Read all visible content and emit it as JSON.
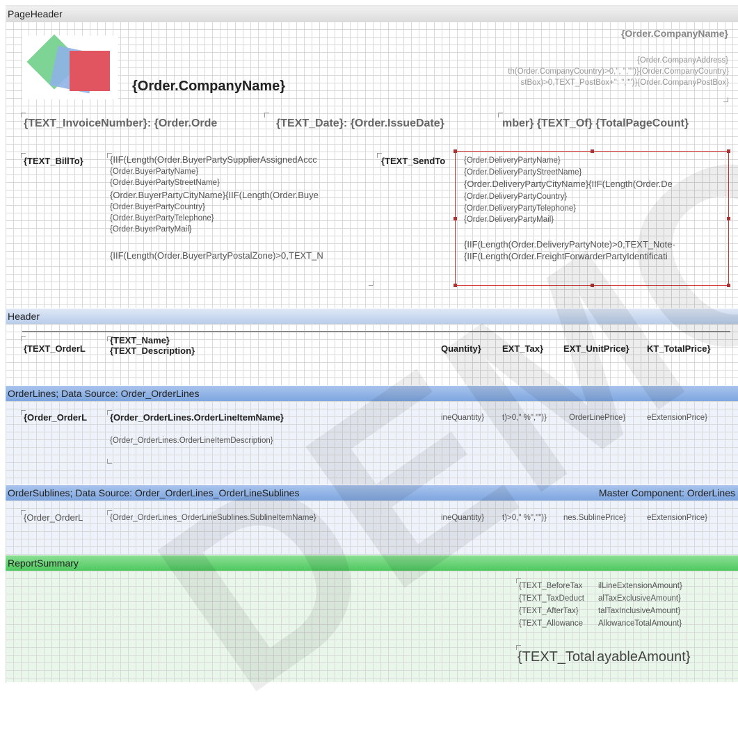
{
  "bands": {
    "page_header": {
      "title": "PageHeader"
    },
    "header": {
      "title": "Header"
    },
    "order_lines": {
      "title": "OrderLines; Data Source: Order_OrderLines"
    },
    "order_sublines": {
      "title": "OrderSublines; Data Source: Order_OrderLines_OrderLineSublines",
      "master": "Master Component: OrderLines"
    },
    "report_summary": {
      "title": "ReportSummary"
    }
  },
  "page_header": {
    "company_name_big": "{Order.CompanyName}",
    "company_name_right": "{Order.CompanyName}",
    "company_address": "{Order.CompanyAddress}",
    "company_country_expr": "th(Order.CompanyCountry)>0,\", \",\"\")}{Order.CompanyCountry}",
    "postbox_expr": "stBox)>0,TEXT_PostBox+\": \",\"\")}{Order.CompanyPostBox}",
    "invoice_number": "{TEXT_InvoiceNumber}: {Order.Orde",
    "date": "{TEXT_Date}: {Order.IssueDate}",
    "page_count": "mber} {TEXT_Of} {TotalPageCount}",
    "bill_to_label": "{TEXT_BillTo}",
    "send_to_label": "{TEXT_SendTo",
    "buyer_lines": [
      "{IIF(Length(Order.BuyerPartySupplierAssignedAccc",
      "{Order.BuyerPartyName}",
      "{Order.BuyerPartyStreetName}",
      "{Order.BuyerPartyCityName}{IIF(Length(Order.Buye",
      "{Order.BuyerPartyCountry}",
      "{Order.BuyerPartyTelephone}",
      "{Order.BuyerPartyMail}",
      "",
      "{IIF(Length(Order.BuyerPartyPostalZone)>0,TEXT_N"
    ],
    "delivery_lines": [
      "{Order.DeliveryPartyName}",
      "{Order.DeliveryPartyStreetName}",
      "{Order.DeliveryPartyCityName}{IIF(Length(Order.De",
      "{Order.DeliveryPartyCountry}",
      "{Order.DeliveryPartyTelephone}",
      "{Order.DeliveryPartyMail}",
      "",
      "{IIF(Length(Order.DeliveryPartyNote)>0,TEXT_Note-",
      "{IIF(Length(Order.FreightForwarderPartyIdentificati"
    ]
  },
  "header": {
    "order_line": "{TEXT_OrderL",
    "name": "{TEXT_Name}",
    "description": "{TEXT_Description}",
    "quantity": "Quantity}",
    "tax": "EXT_Tax}",
    "unit_price": "EXT_UnitPrice}",
    "total_price": "KT_TotalPrice}"
  },
  "order_lines": {
    "order_line": "{Order_OrderL",
    "item_name": "{Order_OrderLines.OrderLineItemName}",
    "item_description": "{Order_OrderLines.OrderLineItemDescription}",
    "quantity": "ineQuantity}",
    "tax": "t)>0,\" %\",\"\")}",
    "price": "OrderLinePrice}",
    "extension": "eExtensionPrice}"
  },
  "order_sublines": {
    "order_line": "{Order_OrderL",
    "item_name": "{Order_OrderLines_OrderLineSublines.SublineItemName}",
    "quantity": "ineQuantity}",
    "tax": "t)>0,\" %\",\"\")}",
    "price": "nes.SublinePrice}",
    "extension": "eExtensionPrice}"
  },
  "summary": {
    "rows": [
      {
        "label": "{TEXT_BeforeTax",
        "value": "ilLineExtensionAmount}"
      },
      {
        "label": "{TEXT_TaxDeduct",
        "value": "alTaxExclusiveAmount}"
      },
      {
        "label": "{TEXT_AfterTax}",
        "value": "talTaxInclusiveAmount}"
      },
      {
        "label": "{TEXT_Allowance",
        "value": "AllowanceTotalAmount}"
      }
    ],
    "total_label": "{TEXT_Total",
    "total_value": "ayableAmount}"
  },
  "watermark": "DEMO",
  "colors": {
    "band_gray": "#e4e4e4",
    "band_blue": "#7ea6e0",
    "band_green": "#5fd070",
    "selection_red": "#d32f2f"
  }
}
